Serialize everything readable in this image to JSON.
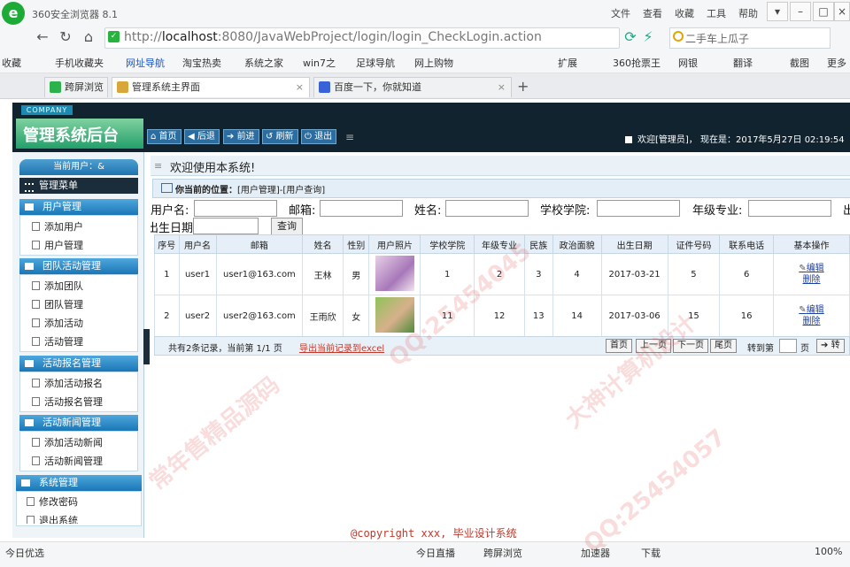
{
  "browser": {
    "title": "360安全浏览器 8.1",
    "menu": [
      "文件",
      "查看",
      "收藏",
      "工具",
      "帮助"
    ],
    "url_prefix": "http://",
    "url_host": "localhost",
    "url_rest": ":8080/JavaWebProject/login/login_CheckLogin.action",
    "search_text": "二手车上瓜子",
    "bookmarks": [
      "收藏",
      "手机收藏夹",
      "网址导航",
      "淘宝热卖",
      "系统之家",
      "win7之",
      "足球导航",
      "网上购物",
      "扩展",
      "360抢票王",
      "网银",
      "翻译",
      "截图",
      "更多"
    ],
    "tabs": [
      "跨屏浏览",
      "管理系统主界面",
      "百度一下，你就知道"
    ]
  },
  "header": {
    "company": "COMPANY",
    "title": "管理系统后台",
    "buttons": [
      "首页",
      "后退",
      "前进",
      "刷新",
      "退出"
    ],
    "welcome": "欢迎[管理员]，  现在是：2017年5月27日 02:19:54"
  },
  "sidebar": {
    "current_user": "当前用户：&",
    "manage_menu": "管理菜单",
    "sections": [
      {
        "title": "用户管理",
        "items": [
          "添加用户",
          "用户管理"
        ]
      },
      {
        "title": "团队活动管理",
        "items": [
          "添加团队",
          "团队管理",
          "添加活动",
          "活动管理"
        ]
      },
      {
        "title": "活动报名管理",
        "items": [
          "添加活动报名",
          "活动报名管理"
        ]
      },
      {
        "title": "活动新闻管理",
        "items": [
          "添加活动新闻",
          "活动新闻管理"
        ]
      },
      {
        "title": "系统管理",
        "items": [
          "修改密码",
          "退出系统"
        ]
      }
    ]
  },
  "main": {
    "welcome": "欢迎使用本系统!",
    "position_label": "你当前的位置：",
    "position_path": "[用户管理]-[用户查询]",
    "filters": {
      "username": "用户名:",
      "email": "邮箱:",
      "name": "姓名:",
      "college": "学校学院:",
      "major": "年级专业:",
      "birthday": "出生日期:",
      "query": "查询"
    },
    "columns": [
      "序号",
      "用户名",
      "邮箱",
      "姓名",
      "性别",
      "用户照片",
      "学校学院",
      "年级专业",
      "民族",
      "政治面貌",
      "出生日期",
      "证件号码",
      "联系电话",
      "基本操作"
    ],
    "rows": [
      [
        "1",
        "user1",
        "user1@163.com",
        "王林",
        "男",
        "",
        "1",
        "2",
        "3",
        "4",
        "2017-03-21",
        "5",
        "6"
      ],
      [
        "2",
        "user2",
        "user2@163.com",
        "王雨欣",
        "女",
        "",
        "11",
        "12",
        "13",
        "14",
        "2017-03-06",
        "15",
        "16"
      ]
    ],
    "edit": "编辑",
    "delete": "删除",
    "pager": {
      "summary": "共有2条记录，当前第 1/1 页",
      "export": "导出当前记录到excel",
      "first": "首页",
      "prev": "上一页",
      "next": "下一页",
      "last": "尾页",
      "goto": "转到第",
      "page": "页",
      "go": "转"
    }
  },
  "copyright": "@copyright xxx, 毕业设计系统",
  "statusbar": [
    "今日优选",
    "今日直播",
    "跨屏浏览",
    "加速器",
    "下载",
    "100%"
  ],
  "watermarks": [
    "常年售精品源码",
    "QQ:25454045",
    "大神计算机设计",
    "QQ:25454057"
  ]
}
